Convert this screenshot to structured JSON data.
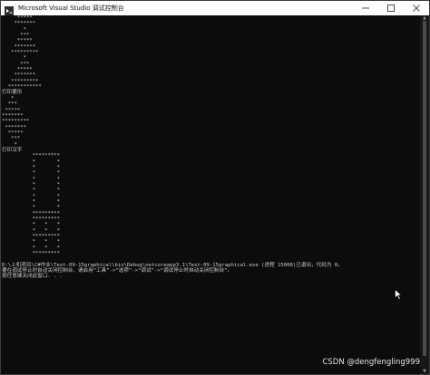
{
  "window": {
    "title": "Microsoft Visual Studio 调试控制台",
    "controls": {
      "minimize_icon": "minimize-icon",
      "maximize_icon": "maximize-icon",
      "close_icon": "close-icon"
    }
  },
  "console": {
    "lines": [
      "     *****",
      "    *******",
      "       *",
      "      ***",
      "     *****",
      "    *******",
      "   *********",
      "       *",
      "      ***",
      "     *****",
      "    *******",
      "   *********",
      "  ***********",
      "打印菱形",
      "   *",
      "  ***",
      " *****",
      "*******",
      "*********",
      " *******",
      "  *****",
      "   ***",
      "    *",
      "打印汉字",
      "          *********",
      "          *       *",
      "          *       *",
      "          *       *",
      "          *       *",
      "          *       *",
      "          *       *",
      "          *       *",
      "          *       *",
      "          *       *",
      "          *********",
      "          *********",
      "          *   *   *",
      "          *   *   *",
      "          *********",
      "          *   *   *",
      "          *   *   *",
      "          *********",
      "",
      "D:\\上机项目\\C#作业\\Text-09-15graphical\\bin\\Debug\\netcoreapp3.1\\Text-09-15graphical.exe (进程 15008)已退出，代码为 0。",
      "要在调试停止时自动关闭控制台，请启用“工具”->“选项”->“调试”->“调试停止时自动关闭控制台”。",
      "按任意键关闭此窗口. . ."
    ]
  },
  "watermark": "CSDN @dengfengling999",
  "colors": {
    "console_bg": "#0c0c0c",
    "console_text": "#cccccc",
    "titlebar_bg": "#ffffff"
  }
}
